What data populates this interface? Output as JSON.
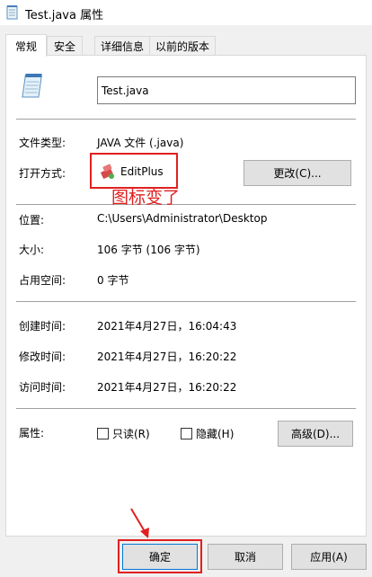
{
  "window": {
    "title": "Test.java 属性"
  },
  "tabs": [
    {
      "label": "常规"
    },
    {
      "label": "安全"
    },
    {
      "label": "详细信息"
    },
    {
      "label": "以前的版本"
    }
  ],
  "general": {
    "file_name": "Test.java",
    "file_type_label": "文件类型:",
    "file_type_value": "JAVA 文件 (.java)",
    "open_with_label": "打开方式:",
    "open_with_value": "EditPlus",
    "change_button": "更改(C)...",
    "annotation": "图标变了",
    "location_label": "位置:",
    "location_value": "C:\\Users\\Administrator\\Desktop",
    "size_label": "大小:",
    "size_value": "106 字节 (106 字节)",
    "disk_size_label": "占用空间:",
    "disk_size_value": "0 字节",
    "created_label": "创建时间:",
    "created_value": "2021年4月27日，16:04:43",
    "modified_label": "修改时间:",
    "modified_value": "2021年4月27日，16:20:22",
    "accessed_label": "访问时间:",
    "accessed_value": "2021年4月27日，16:20:22",
    "attributes_label": "属性:",
    "readonly_label": "只读(R)",
    "hidden_label": "隐藏(H)",
    "advanced_button": "高级(D)..."
  },
  "footer": {
    "ok": "确定",
    "cancel": "取消",
    "apply": "应用(A)"
  },
  "colors": {
    "annotation_red": "#e02020",
    "default_button_border": "#0078d7"
  }
}
